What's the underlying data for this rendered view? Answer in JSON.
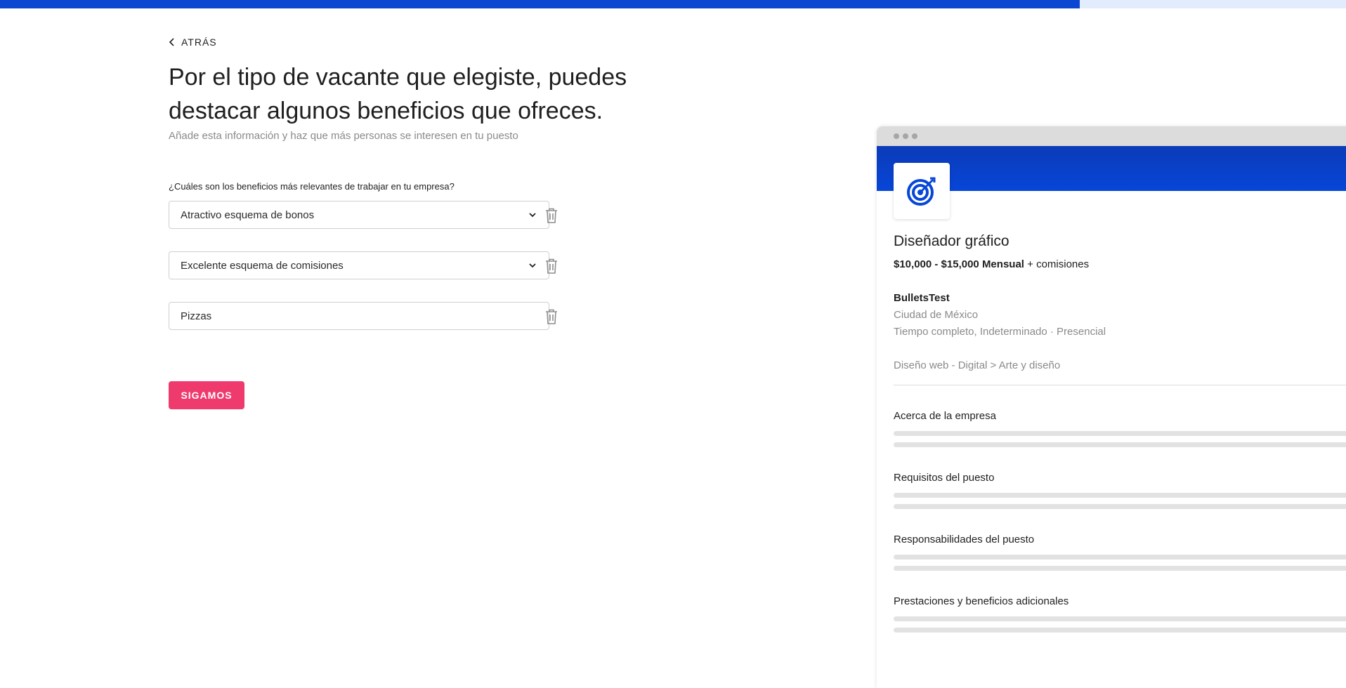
{
  "progress": {
    "percent": 80.2,
    "fill_color": "#0b48d1",
    "track_color": "#e3ecfc"
  },
  "back": {
    "label": "ATRÁS",
    "icon": "chevron-left-icon"
  },
  "header": {
    "title_line1": "Por el tipo de vacante que elegiste, puedes",
    "title_line2": "destacar algunos beneficios que ofreces.",
    "subtitle": "Añade esta información y haz que más personas se interesen en tu puesto"
  },
  "benefits": {
    "question": "¿Cuáles son los beneficios más relevantes de trabajar en tu empresa?",
    "items": [
      {
        "value": "Atractivo esquema de bonos",
        "type": "select"
      },
      {
        "value": "Excelente esquema de comisiones",
        "type": "select"
      },
      {
        "value": "Pizzas",
        "type": "text"
      }
    ]
  },
  "cta": {
    "label": "SIGAMOS",
    "color": "#ef3a6e"
  },
  "preview": {
    "logo_icon": "target-icon",
    "job_title": "Diseñador gráfico",
    "salary_range": "$10,000 - $15,000 Mensual",
    "salary_extra": "+ comisiones",
    "company": "BulletsTest",
    "location": "Ciudad de México",
    "job_type": "Tiempo completo, Indeterminado · Presencial",
    "category": "Diseño web - Digital > Arte y diseño",
    "sections": [
      "Acerca de la empresa",
      "Requisitos del puesto",
      "Responsabilidades del puesto",
      "Prestaciones y beneficios adicionales"
    ],
    "brand_color": "#0746d8"
  }
}
